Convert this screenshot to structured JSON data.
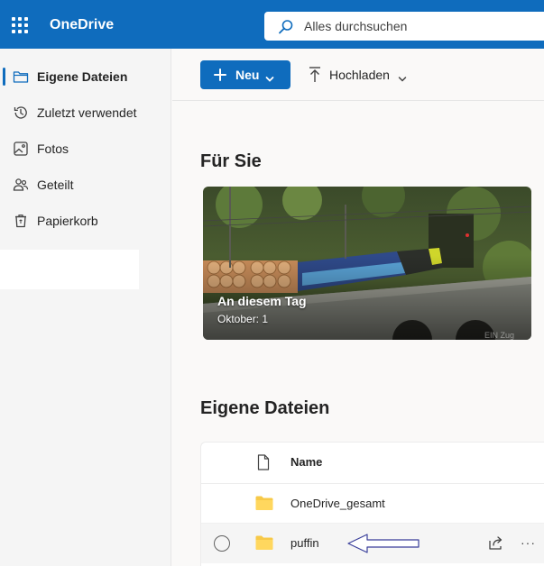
{
  "topbar": {
    "app_title": "OneDrive",
    "search_placeholder": "Alles durchsuchen",
    "brand_color": "#0f6cbd"
  },
  "sidebar": {
    "items": [
      {
        "label": "Eigene Dateien",
        "icon": "folder-icon",
        "active": true
      },
      {
        "label": "Zuletzt verwendet",
        "icon": "history-icon",
        "active": false
      },
      {
        "label": "Fotos",
        "icon": "image-icon",
        "active": false
      },
      {
        "label": "Geteilt",
        "icon": "people-icon",
        "active": false
      },
      {
        "label": "Papierkorb",
        "icon": "trash-icon",
        "active": false
      }
    ]
  },
  "toolbar": {
    "new_label": "Neu",
    "upload_label": "Hochladen"
  },
  "for_you": {
    "title": "Für Sie",
    "card": {
      "title": "An diesem Tag",
      "subtitle": "Oktober: 1",
      "watermark": "EIN Zug"
    }
  },
  "my_files": {
    "title": "Eigene Dateien",
    "column_name": "Name",
    "files": [
      {
        "name": "OneDrive_gesamt",
        "type": "folder"
      },
      {
        "name": "puffin",
        "type": "folder"
      }
    ]
  }
}
